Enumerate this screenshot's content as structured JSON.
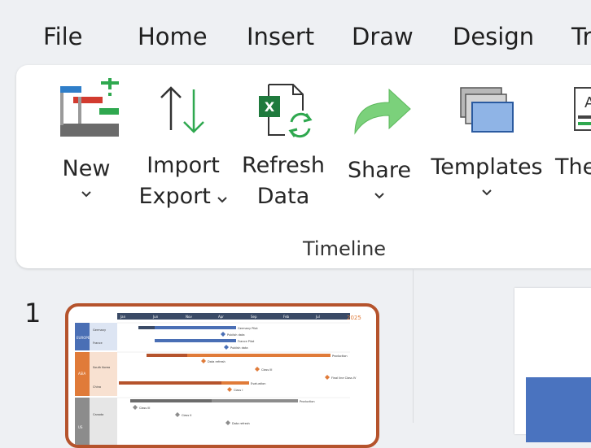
{
  "menu": {
    "tabs": [
      {
        "label": "File"
      },
      {
        "label": "Home"
      },
      {
        "label": "Insert"
      },
      {
        "label": "Draw"
      },
      {
        "label": "Design"
      },
      {
        "label": "Tr"
      }
    ]
  },
  "ribbon": {
    "group_label": "Timeline",
    "buttons": {
      "new": {
        "label": "New"
      },
      "import_export": {
        "line1": "Import",
        "line2": "Export"
      },
      "refresh": {
        "line1": "Refresh",
        "line2": "Data"
      },
      "share": {
        "label": "Share"
      },
      "templates": {
        "label": "Templates"
      },
      "themes": {
        "label": "The"
      }
    }
  },
  "slides_panel": {
    "slide_number": "1",
    "thumbnail": {
      "year": "2025",
      "months": [
        "Jan",
        "Jun",
        "Nov",
        "Apr",
        "Sep",
        "Feb",
        "Jul"
      ],
      "groups": [
        {
          "name": "EUROPE",
          "color": "#4a6fb5",
          "rows": [
            "Germany",
            "France"
          ]
        },
        {
          "name": "ASIA",
          "color": "#e07b39",
          "rows": [
            "South Korea",
            "China"
          ]
        },
        {
          "name": "US",
          "color": "#8c8c8c",
          "rows": [
            "Canada"
          ]
        }
      ],
      "task_labels": [
        "Germany Pilot",
        "Publish data",
        "France Pilot",
        "Publish data",
        "Production",
        "Data refresh",
        "Class III",
        "Final line Class IV",
        "Evaluation",
        "Class I",
        "Production",
        "Class III",
        "Class II",
        "Data refresh"
      ]
    }
  },
  "colors": {
    "accent_border": "#b5532c",
    "europe_bar": "#4a6fb5",
    "asia_bar": "#e07b39",
    "us_bar": "#8c8c8c"
  }
}
